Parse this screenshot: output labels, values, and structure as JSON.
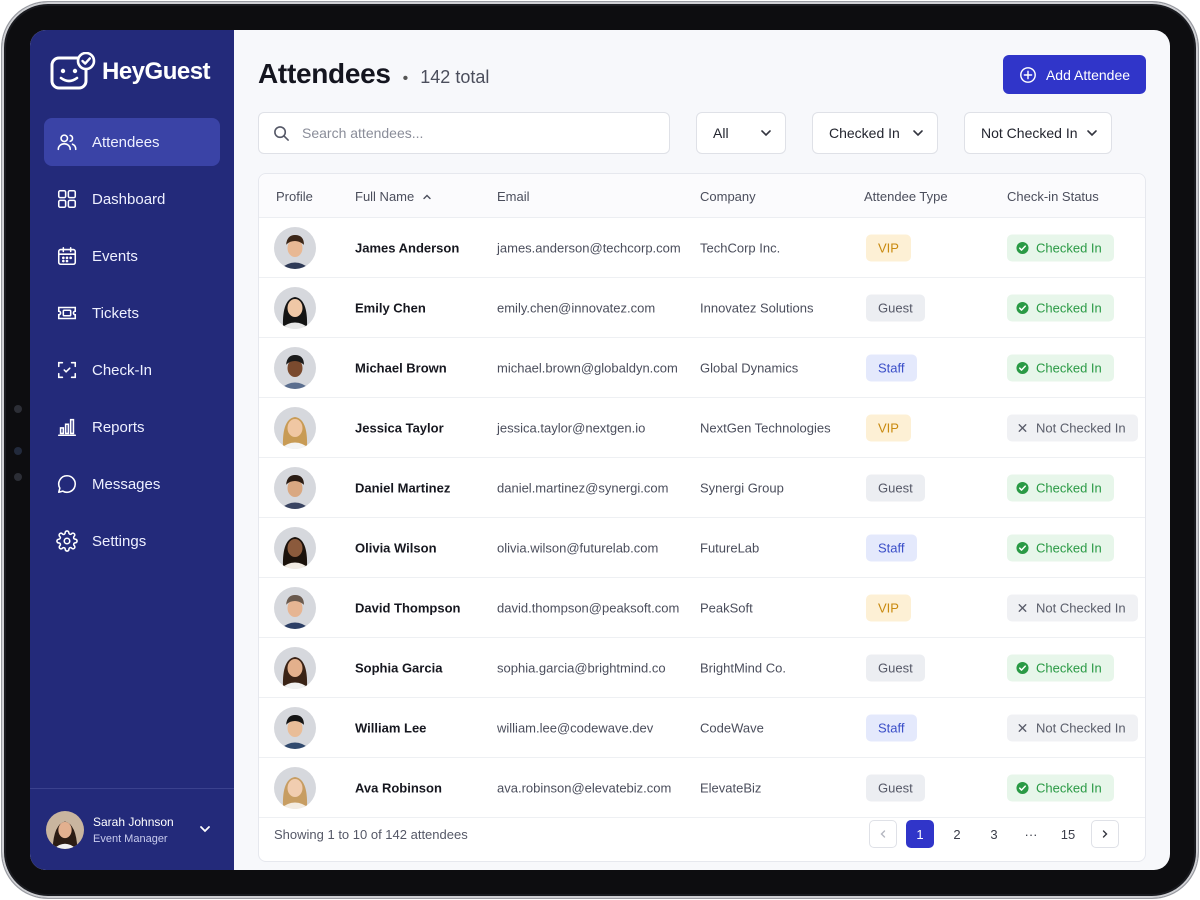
{
  "app": {
    "name": "HeyGuest",
    "logo_icon": "guest-face-check-logo"
  },
  "sidebar": {
    "items": [
      {
        "label": "Attendees",
        "icon": "users-icon",
        "active": true
      },
      {
        "label": "Dashboard",
        "icon": "grid-icon",
        "active": false
      },
      {
        "label": "Events",
        "icon": "calendar-icon",
        "active": false
      },
      {
        "label": "Tickets",
        "icon": "ticket-icon",
        "active": false
      },
      {
        "label": "Check-In",
        "icon": "scan-icon",
        "active": false
      },
      {
        "label": "Reports",
        "icon": "bar-chart-icon",
        "active": false
      },
      {
        "label": "Messages",
        "icon": "chat-icon",
        "active": false
      },
      {
        "label": "Settings",
        "icon": "gear-icon",
        "active": false
      }
    ],
    "user": {
      "name": "Sarah Johnson",
      "role": "Event Manager"
    }
  },
  "header": {
    "title": "Attendees",
    "separator": "•",
    "total": "142 total",
    "add_button": "Add Attendee"
  },
  "search": {
    "placeholder": "Search attendees...",
    "value": ""
  },
  "filters": {
    "all": "All",
    "checked_in": "Checked In",
    "not_checked_in": "Not Checked In"
  },
  "table": {
    "columns": [
      "Profile",
      "Full Name",
      "Email",
      "Company",
      "Attendee Type",
      "Check-in Status"
    ],
    "sort_column": "Full Name",
    "rows": [
      {
        "name": "James Anderson",
        "email": "james.anderson@techcorp.com",
        "company": "TechCorp Inc.",
        "type": "VIP",
        "status": "Checked In"
      },
      {
        "name": "Emily Chen",
        "email": "emily.chen@innovatez.com",
        "company": "Innovatez Solutions",
        "type": "Guest",
        "status": "Checked In"
      },
      {
        "name": "Michael Brown",
        "email": "michael.brown@globaldyn.com",
        "company": "Global Dynamics",
        "type": "Staff",
        "status": "Checked In"
      },
      {
        "name": "Jessica Taylor",
        "email": "jessica.taylor@nextgen.io",
        "company": "NextGen Technologies",
        "type": "VIP",
        "status": "Not Checked In"
      },
      {
        "name": "Daniel Martinez",
        "email": "daniel.martinez@synergi.com",
        "company": "Synergi Group",
        "type": "Guest",
        "status": "Checked In"
      },
      {
        "name": "Olivia Wilson",
        "email": "olivia.wilson@futurelab.com",
        "company": "FutureLab",
        "type": "Staff",
        "status": "Checked In"
      },
      {
        "name": "David Thompson",
        "email": "david.thompson@peaksoft.com",
        "company": "PeakSoft",
        "type": "VIP",
        "status": "Not Checked In"
      },
      {
        "name": "Sophia Garcia",
        "email": "sophia.garcia@brightmind.co",
        "company": "BrightMind Co.",
        "type": "Guest",
        "status": "Checked In"
      },
      {
        "name": "William Lee",
        "email": "william.lee@codewave.dev",
        "company": "CodeWave",
        "type": "Staff",
        "status": "Not Checked In"
      },
      {
        "name": "Ava Robinson",
        "email": "ava.robinson@elevatebiz.com",
        "company": "ElevateBiz",
        "type": "Guest",
        "status": "Checked In"
      }
    ],
    "footer": "Showing 1 to 10 of 142 attendees"
  },
  "pagination": {
    "pages": [
      "1",
      "2",
      "3",
      "···",
      "15"
    ],
    "current": "1"
  },
  "colors": {
    "sidebar": "#232a7a",
    "sidebar_active": "#3a43a6",
    "primary": "#3035c9",
    "vip": "#c98a10",
    "staff": "#3a4ec8",
    "checked_in": "#2a9a45"
  }
}
